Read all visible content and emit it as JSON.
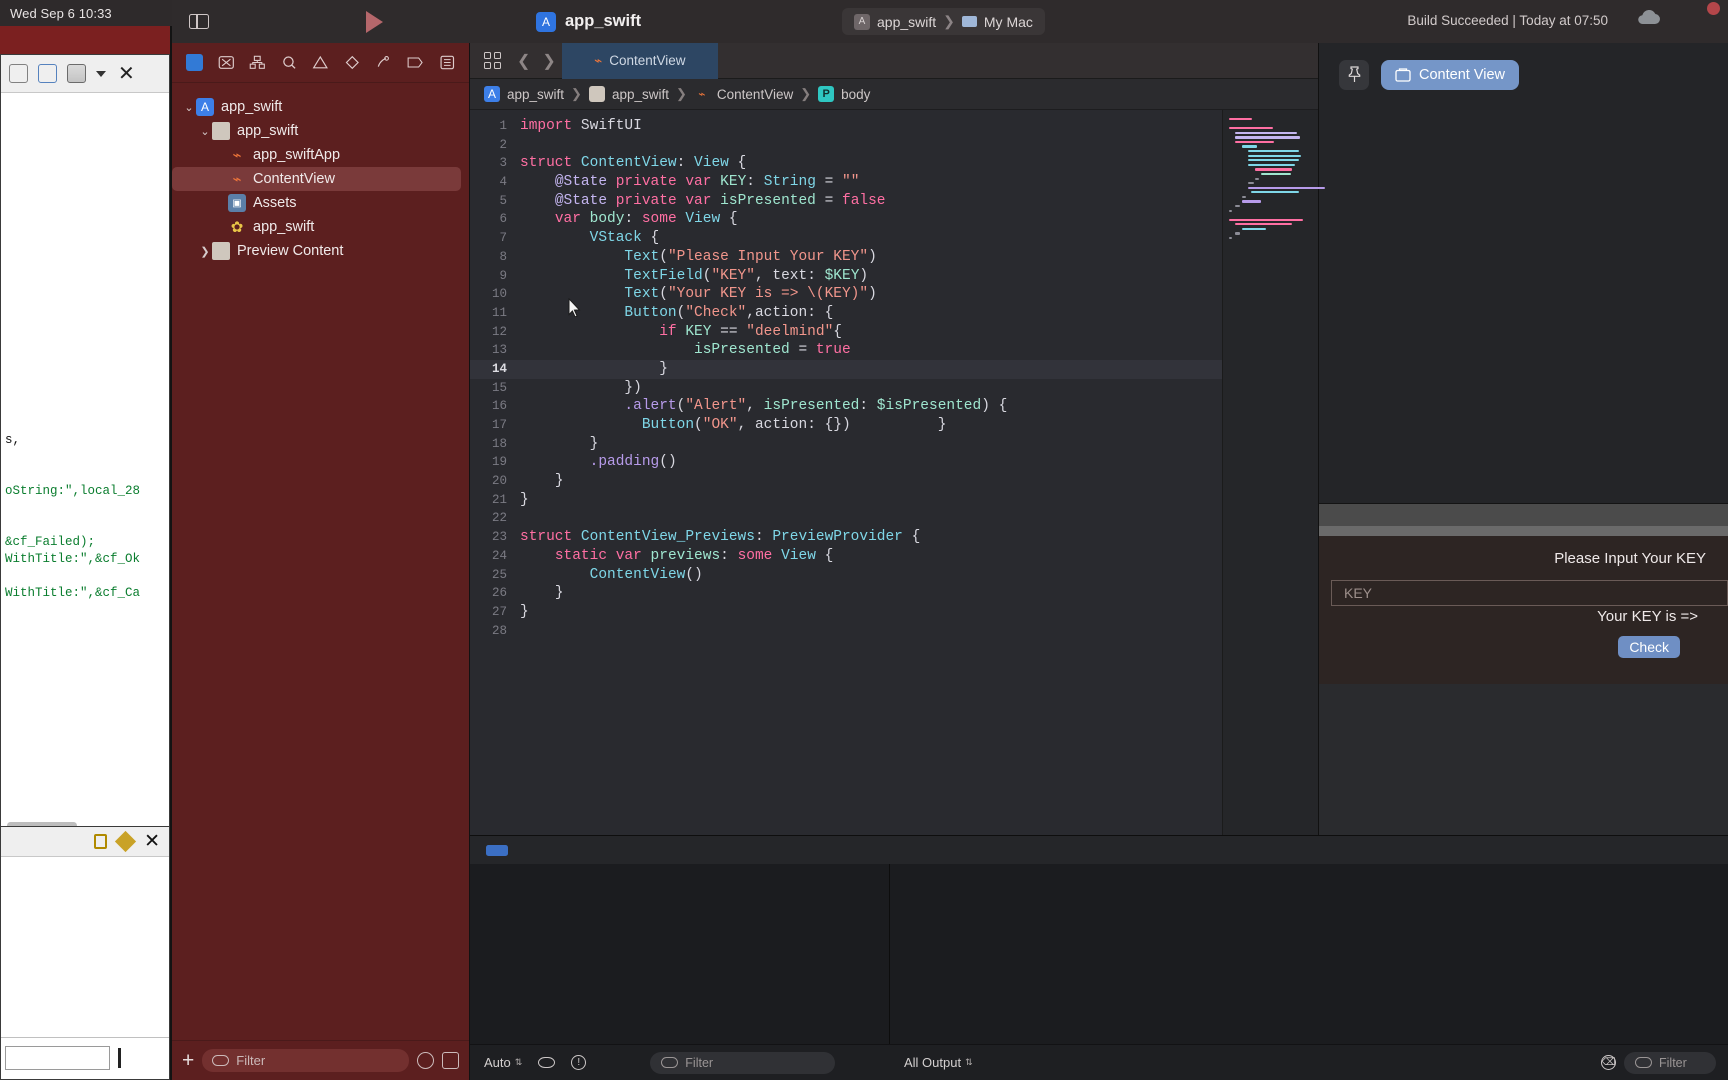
{
  "desktop": {
    "menubar_clock": "Wed Sep 6  10:33",
    "background_code": [
      "s,",
      "oString:\",local_28",
      "&cf_Failed);",
      "WithTitle:\",&cf_Ok",
      "WithTitle:\",&cf_Ca"
    ]
  },
  "titlebar": {
    "app_icon": "xcode-app-icon",
    "app_name": "app_swift",
    "scheme_name": "app_swift",
    "destination": "My Mac",
    "build_status": "Build Succeeded | Today at 07:50",
    "run_icon": "play-icon",
    "sidebar_icon": "sidebar-toggle-icon",
    "cloud_icon": "cloud-icon"
  },
  "navigator": {
    "toolbar_icons": [
      "folder-icon",
      "source-control-icon",
      "hierarchy-icon",
      "search-icon",
      "warning-icon",
      "test-icon",
      "debug-icon",
      "breakpoint-icon",
      "report-icon"
    ],
    "tree": [
      {
        "label": "app_swift",
        "icon": "project-icon",
        "indent": 0,
        "disclosure": "open",
        "selected": false
      },
      {
        "label": "app_swift",
        "icon": "folder-icon",
        "indent": 1,
        "disclosure": "open",
        "selected": false
      },
      {
        "label": "app_swiftApp",
        "icon": "swift-icon",
        "indent": 2,
        "disclosure": "none",
        "selected": false
      },
      {
        "label": "ContentView",
        "icon": "swift-icon",
        "indent": 2,
        "disclosure": "none",
        "selected": true
      },
      {
        "label": "Assets",
        "icon": "assets-icon",
        "indent": 2,
        "disclosure": "none",
        "selected": false
      },
      {
        "label": "app_swift",
        "icon": "gear-icon",
        "indent": 2,
        "disclosure": "none",
        "selected": false
      },
      {
        "label": "Preview Content",
        "icon": "folder-icon",
        "indent": 1,
        "disclosure": "closed",
        "selected": false
      }
    ],
    "footer": {
      "add_label": "+",
      "filter_placeholder": "Filter",
      "recent_icon": "clock-icon",
      "split_icon": "split-icon"
    }
  },
  "editor": {
    "tab_label": "ContentView",
    "tab_icon": "swift-icon",
    "grid_icon": "grid-icon",
    "back_icon": "chevron-left-icon",
    "forward_icon": "chevron-right-icon",
    "breadcrumb": [
      {
        "label": "app_swift",
        "icon": "project-icon"
      },
      {
        "label": "app_swift",
        "icon": "folder-icon"
      },
      {
        "label": "ContentView",
        "icon": "swift-icon"
      },
      {
        "label": "body",
        "icon": "property-icon"
      }
    ],
    "highlight_line": 14,
    "code": [
      {
        "n": 1,
        "tokens": [
          {
            "t": "import",
            "c": "k"
          },
          {
            "t": " SwiftUI",
            "c": "pl"
          }
        ]
      },
      {
        "n": 2,
        "tokens": []
      },
      {
        "n": 3,
        "tokens": [
          {
            "t": "struct",
            "c": "k"
          },
          {
            "t": " ",
            "c": "pl"
          },
          {
            "t": "ContentView",
            "c": "ty"
          },
          {
            "t": ": ",
            "c": "pl"
          },
          {
            "t": "View",
            "c": "ty"
          },
          {
            "t": " {",
            "c": "pl"
          }
        ]
      },
      {
        "n": 4,
        "tokens": [
          {
            "t": "    ",
            "c": "pl"
          },
          {
            "t": "@State",
            "c": "at"
          },
          {
            "t": " ",
            "c": "pl"
          },
          {
            "t": "private",
            "c": "k"
          },
          {
            "t": " ",
            "c": "pl"
          },
          {
            "t": "var",
            "c": "k"
          },
          {
            "t": " ",
            "c": "pl"
          },
          {
            "t": "KEY",
            "c": "vr"
          },
          {
            "t": ": ",
            "c": "pl"
          },
          {
            "t": "String",
            "c": "ty"
          },
          {
            "t": " = ",
            "c": "pl"
          },
          {
            "t": "\"\"",
            "c": "st"
          }
        ]
      },
      {
        "n": 5,
        "tokens": [
          {
            "t": "    ",
            "c": "pl"
          },
          {
            "t": "@State",
            "c": "at"
          },
          {
            "t": " ",
            "c": "pl"
          },
          {
            "t": "private",
            "c": "k"
          },
          {
            "t": " ",
            "c": "pl"
          },
          {
            "t": "var",
            "c": "k"
          },
          {
            "t": " ",
            "c": "pl"
          },
          {
            "t": "isPresented",
            "c": "vr"
          },
          {
            "t": " = ",
            "c": "pl"
          },
          {
            "t": "false",
            "c": "k"
          }
        ]
      },
      {
        "n": 6,
        "tokens": [
          {
            "t": "    ",
            "c": "pl"
          },
          {
            "t": "var",
            "c": "k"
          },
          {
            "t": " ",
            "c": "pl"
          },
          {
            "t": "body",
            "c": "vr"
          },
          {
            "t": ": ",
            "c": "pl"
          },
          {
            "t": "some",
            "c": "k"
          },
          {
            "t": " ",
            "c": "pl"
          },
          {
            "t": "View",
            "c": "ty"
          },
          {
            "t": " {",
            "c": "pl"
          }
        ]
      },
      {
        "n": 7,
        "tokens": [
          {
            "t": "        ",
            "c": "pl"
          },
          {
            "t": "VStack",
            "c": "ty"
          },
          {
            "t": " {",
            "c": "pl"
          }
        ]
      },
      {
        "n": 8,
        "tokens": [
          {
            "t": "            ",
            "c": "pl"
          },
          {
            "t": "Text",
            "c": "ty"
          },
          {
            "t": "(",
            "c": "pl"
          },
          {
            "t": "\"Please Input Your KEY\"",
            "c": "st"
          },
          {
            "t": ")",
            "c": "pl"
          }
        ]
      },
      {
        "n": 9,
        "tokens": [
          {
            "t": "            ",
            "c": "pl"
          },
          {
            "t": "TextField",
            "c": "ty"
          },
          {
            "t": "(",
            "c": "pl"
          },
          {
            "t": "\"KEY\"",
            "c": "st"
          },
          {
            "t": ", ",
            "c": "pl"
          },
          {
            "t": "text",
            "c": "pl"
          },
          {
            "t": ": ",
            "c": "pl"
          },
          {
            "t": "$KEY",
            "c": "vr"
          },
          {
            "t": ")",
            "c": "pl"
          }
        ]
      },
      {
        "n": 10,
        "tokens": [
          {
            "t": "            ",
            "c": "pl"
          },
          {
            "t": "Text",
            "c": "ty"
          },
          {
            "t": "(",
            "c": "pl"
          },
          {
            "t": "\"Your KEY is => \\(KEY)\"",
            "c": "st"
          },
          {
            "t": ")",
            "c": "pl"
          }
        ]
      },
      {
        "n": 11,
        "tokens": [
          {
            "t": "            ",
            "c": "pl"
          },
          {
            "t": "Button",
            "c": "ty"
          },
          {
            "t": "(",
            "c": "pl"
          },
          {
            "t": "\"Check\"",
            "c": "st"
          },
          {
            "t": ",",
            "c": "pl"
          },
          {
            "t": "action",
            "c": "pl"
          },
          {
            "t": ": {",
            "c": "pl"
          }
        ]
      },
      {
        "n": 12,
        "tokens": [
          {
            "t": "                ",
            "c": "pl"
          },
          {
            "t": "if",
            "c": "k"
          },
          {
            "t": " ",
            "c": "pl"
          },
          {
            "t": "KEY",
            "c": "vr"
          },
          {
            "t": " == ",
            "c": "pl"
          },
          {
            "t": "\"deelmind\"",
            "c": "st"
          },
          {
            "t": "{",
            "c": "pl"
          }
        ]
      },
      {
        "n": 13,
        "tokens": [
          {
            "t": "                    ",
            "c": "pl"
          },
          {
            "t": "isPresented",
            "c": "vr"
          },
          {
            "t": " = ",
            "c": "pl"
          },
          {
            "t": "true",
            "c": "k"
          }
        ]
      },
      {
        "n": 14,
        "tokens": [
          {
            "t": "                ",
            "c": "pl"
          },
          {
            "t": "}",
            "c": "pl"
          }
        ]
      },
      {
        "n": 15,
        "tokens": [
          {
            "t": "            ",
            "c": "pl"
          },
          {
            "t": "})",
            "c": "pl"
          }
        ]
      },
      {
        "n": 16,
        "tokens": [
          {
            "t": "            ",
            "c": "pl"
          },
          {
            "t": ".alert",
            "c": "fn"
          },
          {
            "t": "(",
            "c": "pl"
          },
          {
            "t": "\"Alert\"",
            "c": "st"
          },
          {
            "t": ", ",
            "c": "pl"
          },
          {
            "t": "isPresented",
            "c": "vr"
          },
          {
            "t": ": ",
            "c": "pl"
          },
          {
            "t": "$isPresented",
            "c": "vr"
          },
          {
            "t": ") {",
            "c": "pl"
          }
        ]
      },
      {
        "n": 17,
        "tokens": [
          {
            "t": "              ",
            "c": "pl"
          },
          {
            "t": "Button",
            "c": "ty"
          },
          {
            "t": "(",
            "c": "pl"
          },
          {
            "t": "\"OK\"",
            "c": "st"
          },
          {
            "t": ", ",
            "c": "pl"
          },
          {
            "t": "action",
            "c": "pl"
          },
          {
            "t": ": {})",
            "c": "pl"
          },
          {
            "t": "          }",
            "c": "pl"
          }
        ]
      },
      {
        "n": 18,
        "tokens": [
          {
            "t": "        ",
            "c": "pl"
          },
          {
            "t": "}",
            "c": "pl"
          }
        ]
      },
      {
        "n": 19,
        "tokens": [
          {
            "t": "        ",
            "c": "pl"
          },
          {
            "t": ".padding",
            "c": "fn"
          },
          {
            "t": "()",
            "c": "pl"
          }
        ]
      },
      {
        "n": 20,
        "tokens": [
          {
            "t": "    ",
            "c": "pl"
          },
          {
            "t": "}",
            "c": "pl"
          }
        ]
      },
      {
        "n": 21,
        "tokens": [
          {
            "t": "}",
            "c": "pl"
          }
        ]
      },
      {
        "n": 22,
        "tokens": []
      },
      {
        "n": 23,
        "tokens": [
          {
            "t": "struct",
            "c": "k"
          },
          {
            "t": " ",
            "c": "pl"
          },
          {
            "t": "ContentView_Previews",
            "c": "ty"
          },
          {
            "t": ": ",
            "c": "pl"
          },
          {
            "t": "PreviewProvider",
            "c": "ty"
          },
          {
            "t": " {",
            "c": "pl"
          }
        ]
      },
      {
        "n": 24,
        "tokens": [
          {
            "t": "    ",
            "c": "pl"
          },
          {
            "t": "static",
            "c": "k"
          },
          {
            "t": " ",
            "c": "pl"
          },
          {
            "t": "var",
            "c": "k"
          },
          {
            "t": " ",
            "c": "pl"
          },
          {
            "t": "previews",
            "c": "vr"
          },
          {
            "t": ": ",
            "c": "pl"
          },
          {
            "t": "some",
            "c": "k"
          },
          {
            "t": " ",
            "c": "pl"
          },
          {
            "t": "View",
            "c": "ty"
          },
          {
            "t": " {",
            "c": "pl"
          }
        ]
      },
      {
        "n": 25,
        "tokens": [
          {
            "t": "        ",
            "c": "pl"
          },
          {
            "t": "ContentView",
            "c": "ty"
          },
          {
            "t": "()",
            "c": "pl"
          }
        ]
      },
      {
        "n": 26,
        "tokens": [
          {
            "t": "    ",
            "c": "pl"
          },
          {
            "t": "}",
            "c": "pl"
          }
        ]
      },
      {
        "n": 27,
        "tokens": [
          {
            "t": "}",
            "c": "pl"
          }
        ]
      },
      {
        "n": 28,
        "tokens": []
      }
    ]
  },
  "canvas": {
    "pin_icon": "pin-icon",
    "preview_label": "Content View",
    "preview_icon": "window-icon",
    "app": {
      "title_text": "Please Input Your KEY",
      "field_placeholder": "KEY",
      "key_result_text": "Your KEY is =>",
      "check_button": "Check"
    },
    "toolbar_icons": [
      "live-preview-icon",
      "device-selection-icon",
      "variants-icon",
      "layers-icon",
      "inspect-icon"
    ]
  },
  "debug": {
    "left_controls": {
      "auto_label": "Auto",
      "eye_icon": "eye-icon",
      "info_icon": "info-icon",
      "filter_placeholder": "Filter"
    },
    "right_controls": {
      "output_label": "All Output",
      "filter_placeholder": "Filter",
      "trash_icon": "trash-icon"
    }
  },
  "colors": {
    "navigator_bg": "#5c1f1f",
    "accent_blue": "#3b6fc4",
    "tab_selected": "#2d4663",
    "editor_bg": "#292a2f"
  }
}
